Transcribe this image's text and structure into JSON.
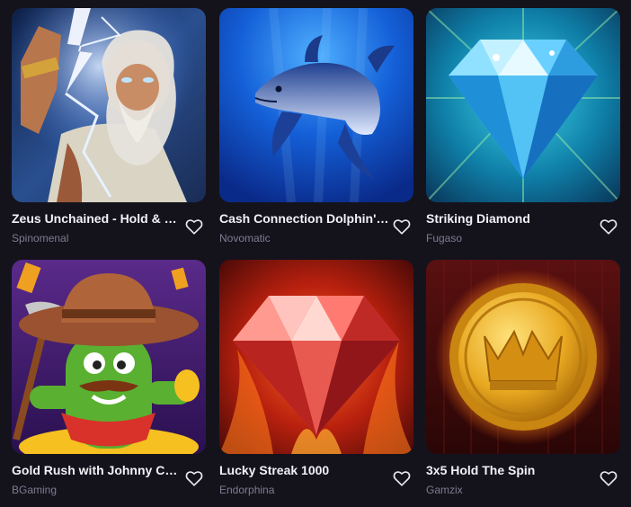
{
  "games": [
    {
      "title": "Zeus Unchained - Hold & Win",
      "provider": "Spinomenal",
      "art_icon": "zeus-art"
    },
    {
      "title": "Cash Connection Dolphin's Pearl",
      "provider": "Novomatic",
      "art_icon": "dolphin-art"
    },
    {
      "title": "Striking Diamond",
      "provider": "Fugaso",
      "art_icon": "blue-diamond-art"
    },
    {
      "title": "Gold Rush with Johnny Cash",
      "provider": "BGaming",
      "art_icon": "cactus-cowboy-art"
    },
    {
      "title": "Lucky Streak 1000",
      "provider": "Endorphina",
      "art_icon": "red-gem-art"
    },
    {
      "title": "3x5 Hold The Spin",
      "provider": "Gamzix",
      "art_icon": "gold-coin-art"
    }
  ],
  "favorite_icon": "heart-outline-icon",
  "colors": {
    "background": "#14131c",
    "title": "#f1f1f6",
    "provider": "#7d7c8f"
  }
}
